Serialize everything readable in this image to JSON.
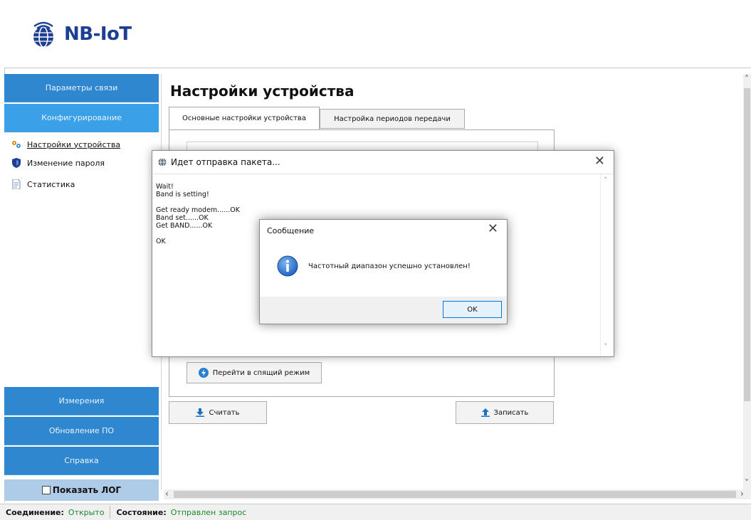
{
  "app": {
    "logo_text": "NB-IoT"
  },
  "sidebar": {
    "top_items": [
      {
        "label": "Параметры связи"
      },
      {
        "label": "Конфигурирование"
      }
    ],
    "sub_items": [
      {
        "label": "Настройки устройства",
        "icon": "gears-icon"
      },
      {
        "label": "Изменение пароля",
        "icon": "shield-icon"
      },
      {
        "label": "Статистика",
        "icon": "document-icon"
      }
    ],
    "bottom_items": [
      {
        "label": "Измерения"
      },
      {
        "label": "Обновление ПО"
      },
      {
        "label": "Справка"
      }
    ],
    "show_log_label": "Показать ЛОГ",
    "show_log_checked": false
  },
  "main": {
    "title": "Настройки устройства",
    "tabs": [
      {
        "label": "Основные настройки устройства"
      },
      {
        "label": "Настройка периодов передачи"
      }
    ],
    "sleep_button": "Перейти в спящий режим",
    "read_button": "Считать",
    "write_button": "Записать"
  },
  "progress_dialog": {
    "title": "Идет отправка пакета...",
    "log": "Wait!\nBand is setting!\n\nGet ready modem......OK\nBand set......OK\nGet BAND......OK\n\nOK"
  },
  "message_box": {
    "title": "Сообщение",
    "text": "Частотный диапазон успешно установлен!",
    "ok_label": "OK"
  },
  "status": {
    "connection_label": "Соединение:",
    "connection_value": "Открыто",
    "state_label": "Состояние:",
    "state_value": "Отправлен запрос"
  },
  "colors": {
    "nav_bg": "#2f87cf",
    "nav_active": "#3aa0e7",
    "status_value": "#1a8a2a",
    "logo": "#1d3f93"
  }
}
